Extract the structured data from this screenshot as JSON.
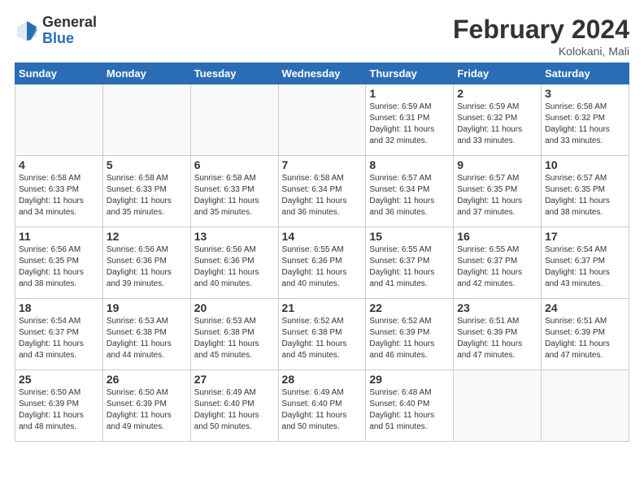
{
  "logo": {
    "general": "General",
    "blue": "Blue"
  },
  "title": "February 2024",
  "subtitle": "Kolokani, Mali",
  "days_of_week": [
    "Sunday",
    "Monday",
    "Tuesday",
    "Wednesday",
    "Thursday",
    "Friday",
    "Saturday"
  ],
  "weeks": [
    [
      {
        "num": "",
        "info": ""
      },
      {
        "num": "",
        "info": ""
      },
      {
        "num": "",
        "info": ""
      },
      {
        "num": "",
        "info": ""
      },
      {
        "num": "1",
        "info": "Sunrise: 6:59 AM\nSunset: 6:31 PM\nDaylight: 11 hours and 32 minutes."
      },
      {
        "num": "2",
        "info": "Sunrise: 6:59 AM\nSunset: 6:32 PM\nDaylight: 11 hours and 33 minutes."
      },
      {
        "num": "3",
        "info": "Sunrise: 6:58 AM\nSunset: 6:32 PM\nDaylight: 11 hours and 33 minutes."
      }
    ],
    [
      {
        "num": "4",
        "info": "Sunrise: 6:58 AM\nSunset: 6:33 PM\nDaylight: 11 hours and 34 minutes."
      },
      {
        "num": "5",
        "info": "Sunrise: 6:58 AM\nSunset: 6:33 PM\nDaylight: 11 hours and 35 minutes."
      },
      {
        "num": "6",
        "info": "Sunrise: 6:58 AM\nSunset: 6:33 PM\nDaylight: 11 hours and 35 minutes."
      },
      {
        "num": "7",
        "info": "Sunrise: 6:58 AM\nSunset: 6:34 PM\nDaylight: 11 hours and 36 minutes."
      },
      {
        "num": "8",
        "info": "Sunrise: 6:57 AM\nSunset: 6:34 PM\nDaylight: 11 hours and 36 minutes."
      },
      {
        "num": "9",
        "info": "Sunrise: 6:57 AM\nSunset: 6:35 PM\nDaylight: 11 hours and 37 minutes."
      },
      {
        "num": "10",
        "info": "Sunrise: 6:57 AM\nSunset: 6:35 PM\nDaylight: 11 hours and 38 minutes."
      }
    ],
    [
      {
        "num": "11",
        "info": "Sunrise: 6:56 AM\nSunset: 6:35 PM\nDaylight: 11 hours and 38 minutes."
      },
      {
        "num": "12",
        "info": "Sunrise: 6:56 AM\nSunset: 6:36 PM\nDaylight: 11 hours and 39 minutes."
      },
      {
        "num": "13",
        "info": "Sunrise: 6:56 AM\nSunset: 6:36 PM\nDaylight: 11 hours and 40 minutes."
      },
      {
        "num": "14",
        "info": "Sunrise: 6:55 AM\nSunset: 6:36 PM\nDaylight: 11 hours and 40 minutes."
      },
      {
        "num": "15",
        "info": "Sunrise: 6:55 AM\nSunset: 6:37 PM\nDaylight: 11 hours and 41 minutes."
      },
      {
        "num": "16",
        "info": "Sunrise: 6:55 AM\nSunset: 6:37 PM\nDaylight: 11 hours and 42 minutes."
      },
      {
        "num": "17",
        "info": "Sunrise: 6:54 AM\nSunset: 6:37 PM\nDaylight: 11 hours and 43 minutes."
      }
    ],
    [
      {
        "num": "18",
        "info": "Sunrise: 6:54 AM\nSunset: 6:37 PM\nDaylight: 11 hours and 43 minutes."
      },
      {
        "num": "19",
        "info": "Sunrise: 6:53 AM\nSunset: 6:38 PM\nDaylight: 11 hours and 44 minutes."
      },
      {
        "num": "20",
        "info": "Sunrise: 6:53 AM\nSunset: 6:38 PM\nDaylight: 11 hours and 45 minutes."
      },
      {
        "num": "21",
        "info": "Sunrise: 6:52 AM\nSunset: 6:38 PM\nDaylight: 11 hours and 45 minutes."
      },
      {
        "num": "22",
        "info": "Sunrise: 6:52 AM\nSunset: 6:39 PM\nDaylight: 11 hours and 46 minutes."
      },
      {
        "num": "23",
        "info": "Sunrise: 6:51 AM\nSunset: 6:39 PM\nDaylight: 11 hours and 47 minutes."
      },
      {
        "num": "24",
        "info": "Sunrise: 6:51 AM\nSunset: 6:39 PM\nDaylight: 11 hours and 47 minutes."
      }
    ],
    [
      {
        "num": "25",
        "info": "Sunrise: 6:50 AM\nSunset: 6:39 PM\nDaylight: 11 hours and 48 minutes."
      },
      {
        "num": "26",
        "info": "Sunrise: 6:50 AM\nSunset: 6:39 PM\nDaylight: 11 hours and 49 minutes."
      },
      {
        "num": "27",
        "info": "Sunrise: 6:49 AM\nSunset: 6:40 PM\nDaylight: 11 hours and 50 minutes."
      },
      {
        "num": "28",
        "info": "Sunrise: 6:49 AM\nSunset: 6:40 PM\nDaylight: 11 hours and 50 minutes."
      },
      {
        "num": "29",
        "info": "Sunrise: 6:48 AM\nSunset: 6:40 PM\nDaylight: 11 hours and 51 minutes."
      },
      {
        "num": "",
        "info": ""
      },
      {
        "num": "",
        "info": ""
      }
    ]
  ]
}
